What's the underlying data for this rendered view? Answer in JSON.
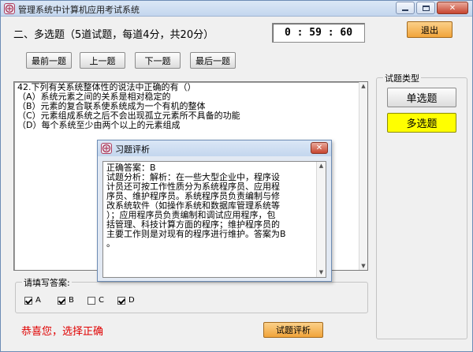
{
  "window": {
    "title": "管理系统中计算机应用考试系统"
  },
  "header": {
    "section_title": "二、多选题（5道试题，每道4分，共20分）",
    "timer": "0 : 59 : 60",
    "exit_label": "退出"
  },
  "nav": {
    "first": "最前一题",
    "prev": "上一题",
    "next": "下一题",
    "last": "最后一题"
  },
  "question": {
    "lines": [
      "42.下列有关系统整体性的说法中正确的有（）",
      "（A）系统元素之间的关系是相对稳定的",
      "（B）元素的复合联系使系统成为一个有机的整体",
      "（C）元素组成系统之后不会出现孤立元素所不具备的功能",
      "（D）每个系统至少由两个以上的元素组成"
    ]
  },
  "question_types": {
    "legend": "试题类型",
    "single": "单选题",
    "multi": "多选题"
  },
  "answer": {
    "legend": "请填写答案:",
    "options": [
      {
        "label": "A",
        "checked": true
      },
      {
        "label": "B",
        "checked": true
      },
      {
        "label": "C",
        "checked": false
      },
      {
        "label": "D",
        "checked": true
      }
    ]
  },
  "feedback": "恭喜您，选择正确",
  "review_label": "试题评析",
  "dialog": {
    "title": "习题评析",
    "lines": [
      "正确答案：B",
      "试题分析：解析：在一些大型企业中，程序设",
      "计员还可按工作性质分为系统程序员、应用程",
      "序员、维护程序员。系统程序员负责编制与修",
      "改系统软件（如操作系统和数据库管理系统等",
      "）；应用程序员负责编制和调试应用程序，包",
      "括管理、科技计算方面的程序；维护程序员的",
      "主要工作则是对现有的程序进行维护。答案为B",
      "。"
    ]
  },
  "colors": {
    "highlight_button": "#ffff00",
    "feedback_text": "#e00000",
    "orange_button": "#f1a43a"
  }
}
